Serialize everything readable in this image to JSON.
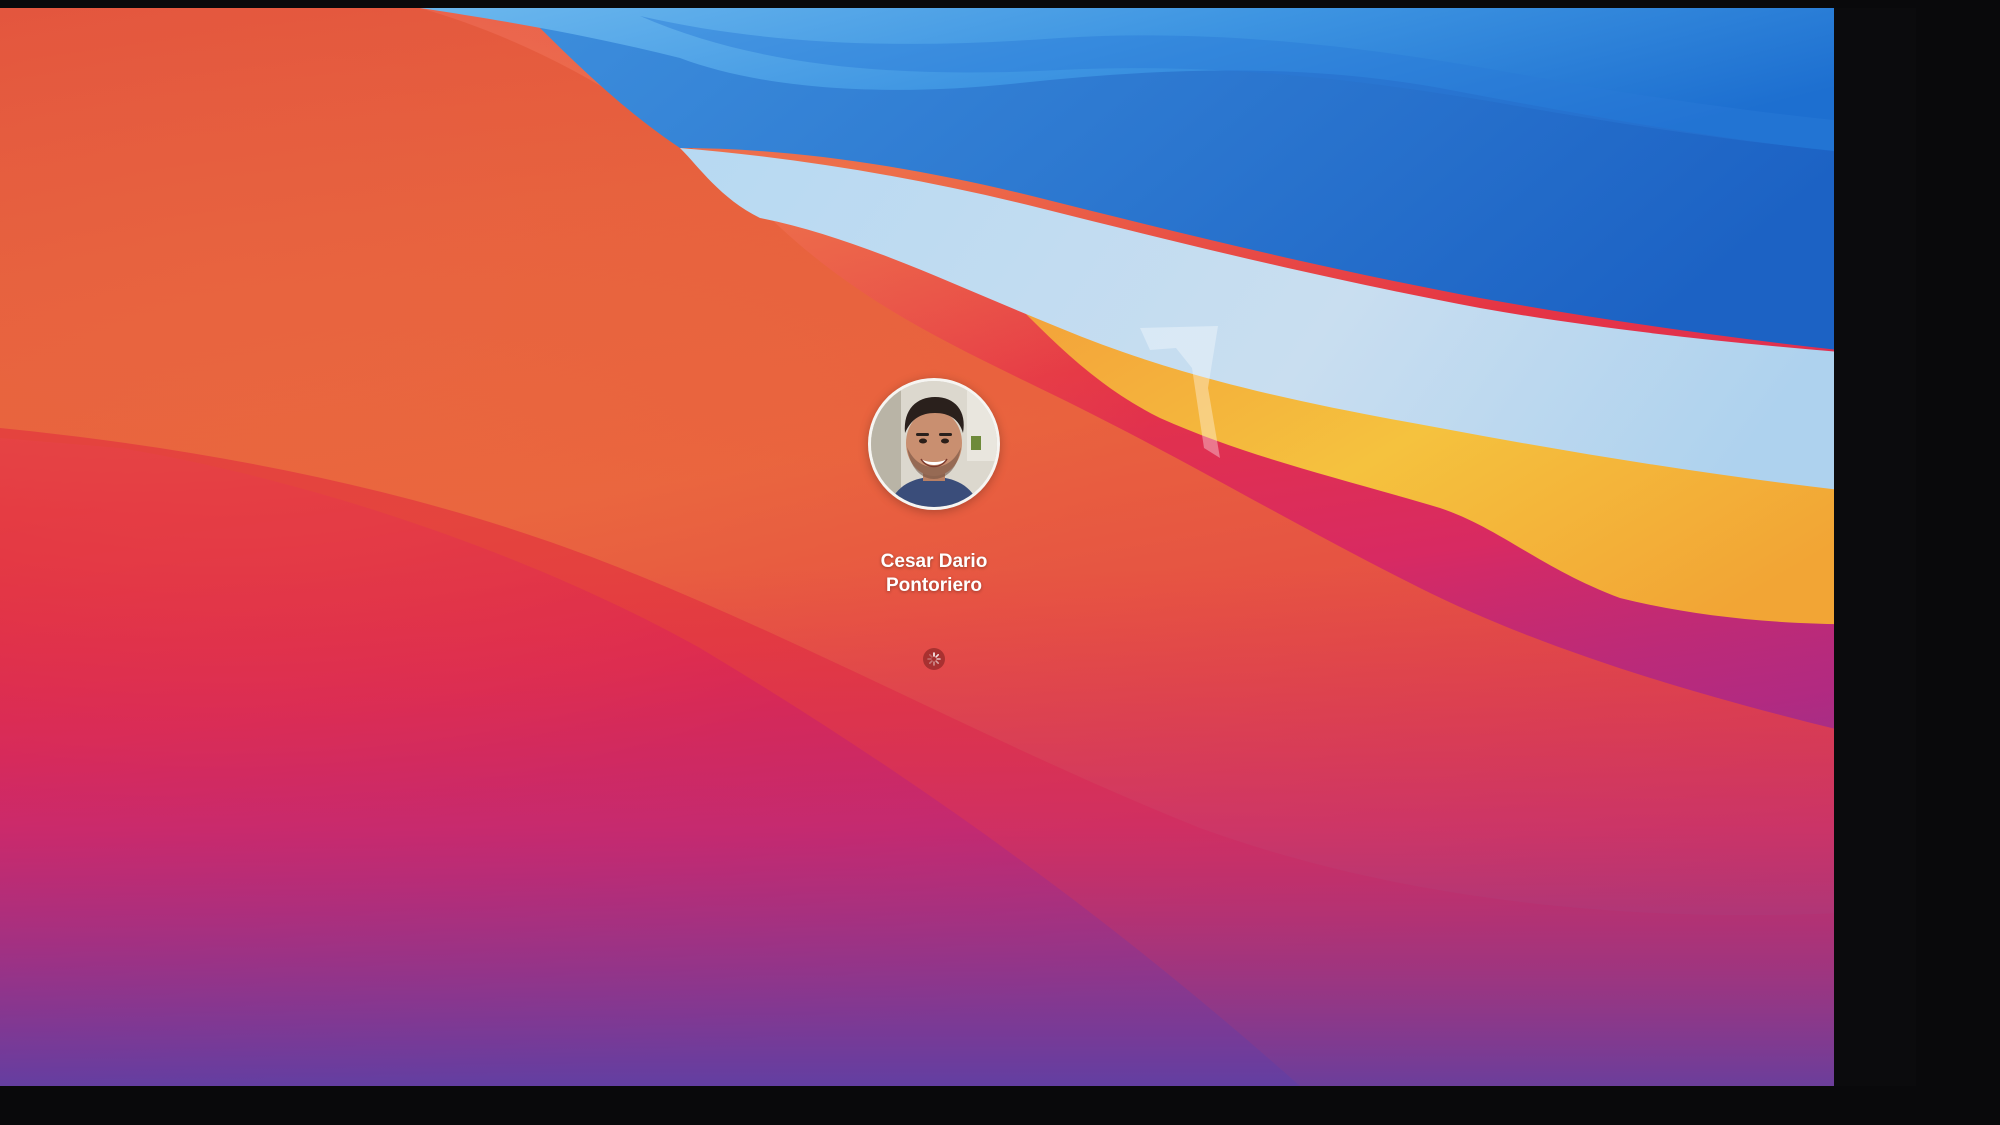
{
  "login": {
    "user_name_line1": "Cesar Dario",
    "user_name_line2": "Pontoriero",
    "avatar_icon": "user-avatar-photo",
    "status_icon": "loading-spinner-icon"
  },
  "colors": {
    "red": "#e3273d",
    "orange": "#ec6a3e",
    "magenta": "#c42a7c",
    "purple": "#5a3ea8",
    "blue": "#2a7fd8",
    "light_blue": "#8cc8f0",
    "yellow": "#f2b63a"
  }
}
